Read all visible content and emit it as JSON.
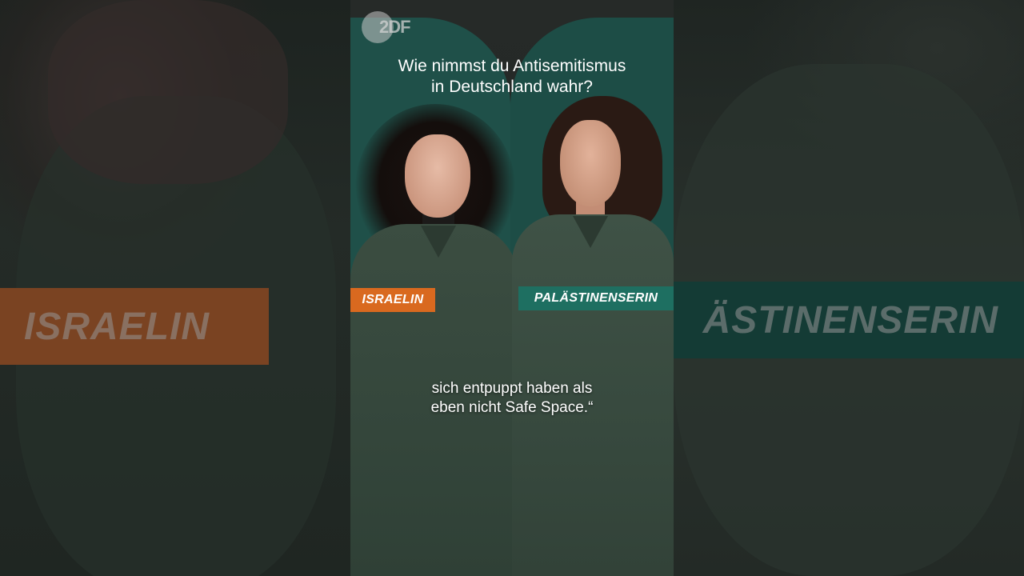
{
  "broadcaster": {
    "logo_text": "2DF"
  },
  "question": {
    "line1": "Wie nimmst du Antisemitismus",
    "line2": "in Deutschland wahr?"
  },
  "labels": {
    "left": "ISRAELIN",
    "right": "PALÄSTINENSERIN"
  },
  "background_tags": {
    "left": "ISRAELIN",
    "right": "ÄSTINENSERIN"
  },
  "subtitle": {
    "line1": "sich entpuppt haben als",
    "line2": "eben nicht Safe Space.“"
  },
  "colors": {
    "israelin_tag": "#d9691f",
    "palaestinenserin_tag": "#1e6f61",
    "backdrop": "#1f5049"
  }
}
